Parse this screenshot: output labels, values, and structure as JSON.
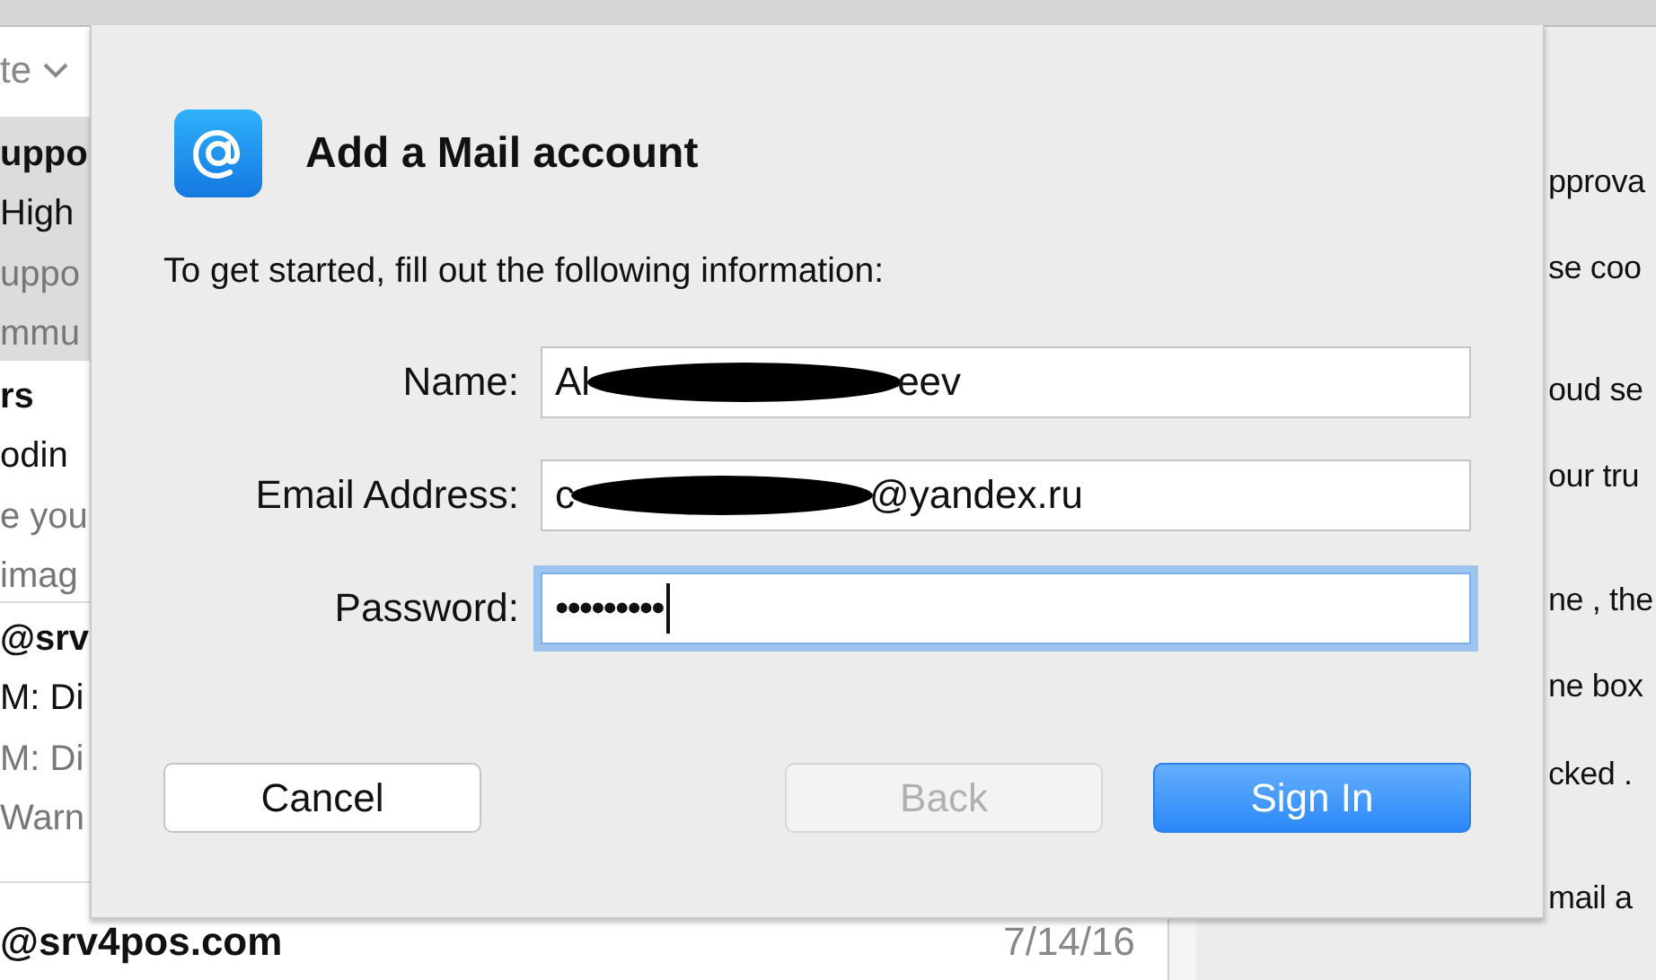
{
  "message_list": {
    "sort_label": "te",
    "rows": [
      {
        "selected": true,
        "sender": "uppo",
        "subject": "High",
        "preview": [
          "uppo",
          "mmu"
        ]
      },
      {
        "selected": false,
        "sender": "rs",
        "subject": "odin",
        "preview": [
          "e you",
          "imag"
        ]
      },
      {
        "selected": false,
        "sender": "@srv",
        "subject": "M: Di",
        "preview": [
          "M: Di",
          "Warn"
        ]
      },
      {
        "selected": false,
        "sender": "@srv4pos.com",
        "date": "7/14/16",
        "preview": []
      }
    ]
  },
  "reading_pane": {
    "lines": [
      "pprova",
      "se coo",
      "oud se",
      "our tru",
      "ne , the",
      "ne box",
      "cked .",
      "mail a"
    ]
  },
  "dialog": {
    "title": "Add a Mail account",
    "instruction": "To get started, fill out the following information:",
    "fields": [
      {
        "label": "Name:",
        "kind": "text",
        "value_start": "Al",
        "value_end": "eev",
        "redacted": true,
        "focused": false
      },
      {
        "label": "Email Address:",
        "kind": "text",
        "value_start": "c",
        "value_end": "@yandex.ru",
        "redacted": true,
        "focused": false
      },
      {
        "label": "Password:",
        "kind": "password",
        "value_start": "•••••••••",
        "focused": true
      }
    ],
    "buttons": [
      {
        "label": "Cancel",
        "kind": "default",
        "disabled": false
      },
      {
        "label": "Back",
        "kind": "default",
        "disabled": true
      },
      {
        "label": "Sign In",
        "kind": "primary",
        "disabled": false
      }
    ]
  }
}
